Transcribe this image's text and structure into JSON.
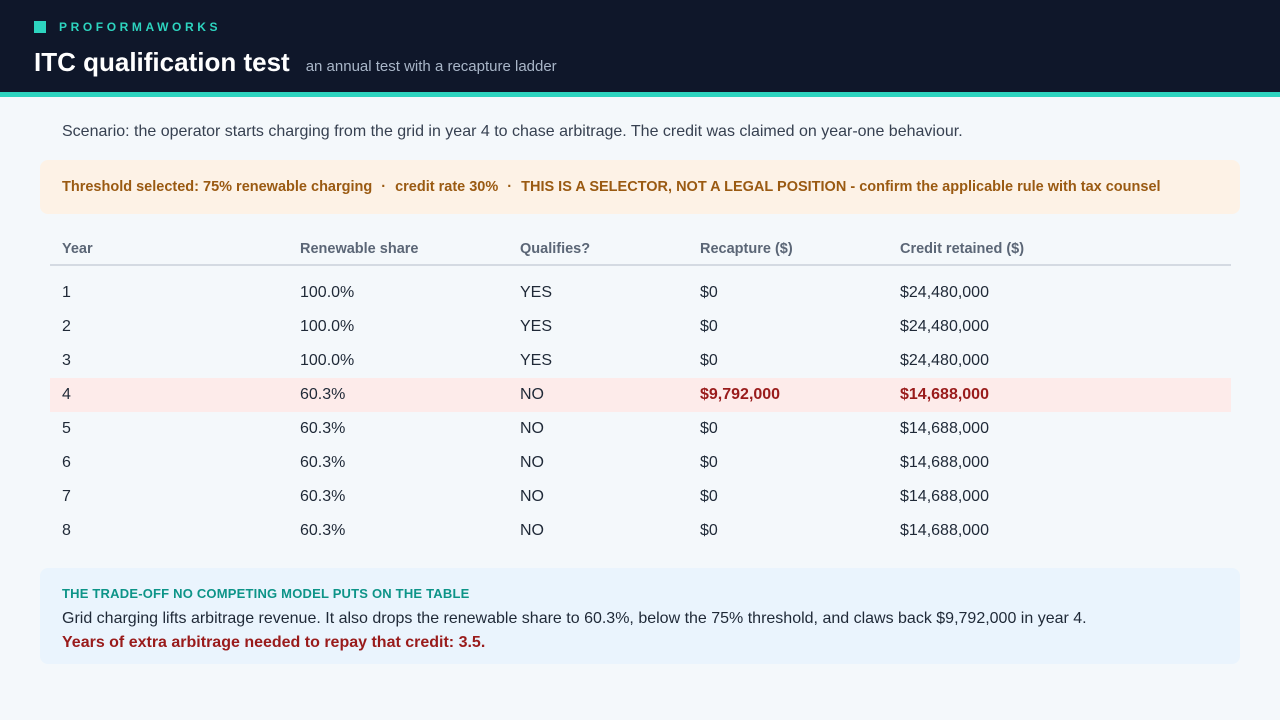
{
  "header": {
    "brand": "PROFORMAWORKS",
    "title": "ITC qualification test",
    "subtitle": "an annual test with a recapture ladder",
    "accent_color": "#2dd4bf",
    "background_color": "#0f172a"
  },
  "scenario": "Scenario: the operator starts charging from the grid in year 4 to chase arbitrage. The credit was claimed on year-one behaviour.",
  "threshold_box": {
    "threshold": "Threshold selected: 75% renewable charging",
    "separator": "·",
    "credit_rate": "credit rate 30%",
    "disclaimer": "THIS IS A SELECTOR, NOT A LEGAL POSITION - confirm the applicable rule with tax counsel"
  },
  "table": {
    "columns": [
      "Year",
      "Renewable share",
      "Qualifies?",
      "Recapture ($)",
      "Credit retained ($)"
    ],
    "highlight_row": 3,
    "rows": [
      [
        "1",
        "100.0%",
        "YES",
        "$0",
        "$24,480,000"
      ],
      [
        "2",
        "100.0%",
        "YES",
        "$0",
        "$24,480,000"
      ],
      [
        "3",
        "100.0%",
        "YES",
        "$0",
        "$24,480,000"
      ],
      [
        "4",
        "60.3%",
        "NO",
        "$9,792,000",
        "$14,688,000"
      ],
      [
        "5",
        "60.3%",
        "NO",
        "$0",
        "$14,688,000"
      ],
      [
        "6",
        "60.3%",
        "NO",
        "$0",
        "$14,688,000"
      ],
      [
        "7",
        "60.3%",
        "NO",
        "$0",
        "$14,688,000"
      ],
      [
        "8",
        "60.3%",
        "NO",
        "$0",
        "$14,688,000"
      ]
    ]
  },
  "tradeoff": {
    "heading": "THE TRADE-OFF NO COMPETING MODEL PUTS ON THE TABLE",
    "body": "Grid charging lifts arbitrage revenue. It also drops the renewable share to 60.3%, below the 75% threshold, and claws back $9,792,000 in year 4.",
    "conclusion": "Years of extra arbitrage needed to repay that credit: 3.5."
  }
}
